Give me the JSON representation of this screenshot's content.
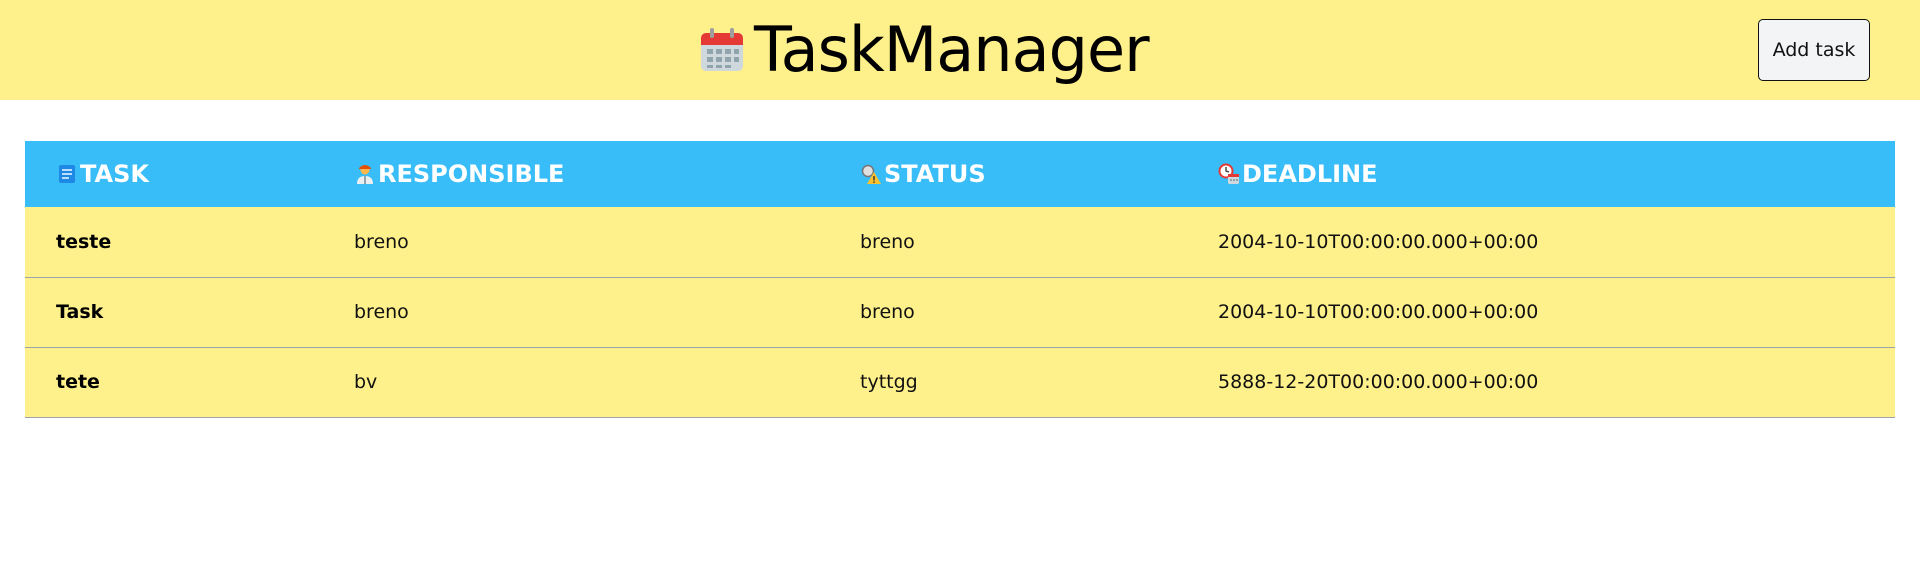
{
  "header": {
    "title": "TaskManager",
    "icon": "calendar-icon",
    "add_button_label": "Add task",
    "background": "#fef08a"
  },
  "table": {
    "header_background": "#38bdf8",
    "row_background": "#fef08a",
    "columns": [
      {
        "label": "TASK",
        "icon": "memo-icon"
      },
      {
        "label": "RESPONSIBLE",
        "icon": "person-icon"
      },
      {
        "label": "STATUS",
        "icon": "warning-magnifier-icon"
      },
      {
        "label": "DEADLINE",
        "icon": "clock-calendar-icon"
      }
    ],
    "rows": [
      {
        "task": "teste",
        "responsible": "breno",
        "status": "breno",
        "deadline": "2004-10-10T00:00:00.000+00:00"
      },
      {
        "task": "Task",
        "responsible": "breno",
        "status": "breno",
        "deadline": "2004-10-10T00:00:00.000+00:00"
      },
      {
        "task": "tete",
        "responsible": "bv",
        "status": "tyttgg",
        "deadline": "5888-12-20T00:00:00.000+00:00"
      }
    ]
  }
}
